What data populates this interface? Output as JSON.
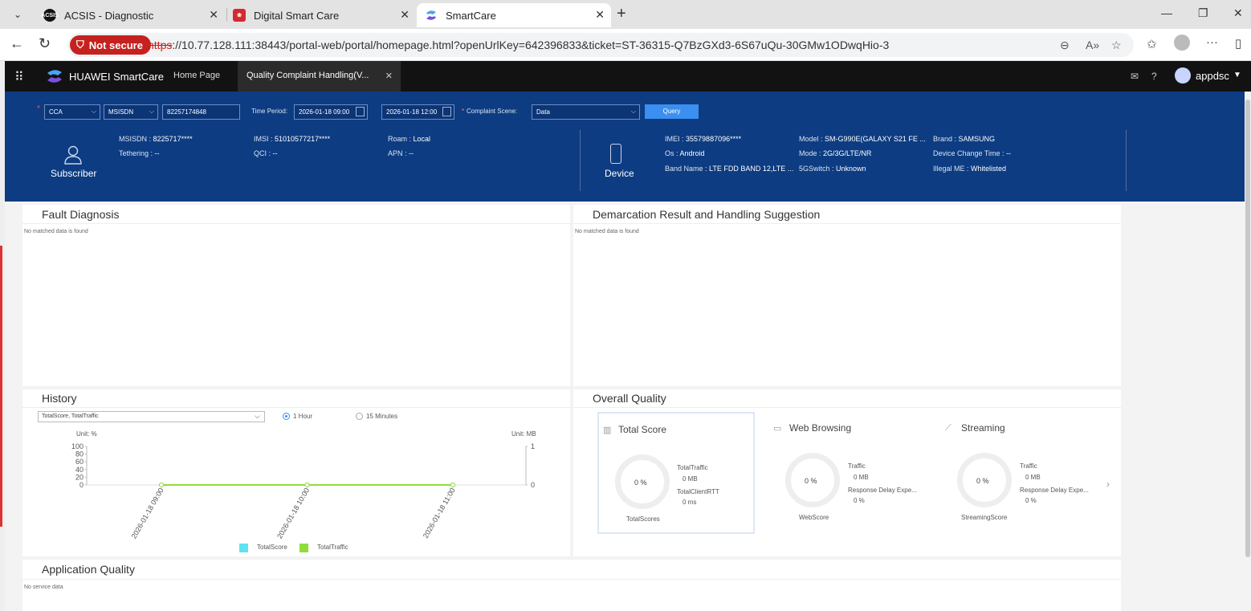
{
  "browser": {
    "tabs": [
      {
        "title": "ACSIS - Diagnostic",
        "favicon": "acsis-icon"
      },
      {
        "title": "Digital Smart Care",
        "favicon": "huawei-icon"
      },
      {
        "title": "SmartCare",
        "favicon": "smartcare-icon",
        "active": true
      }
    ],
    "security_label": "Not secure",
    "url_protocol": "https",
    "url_rest": "://10.77.128.111:38443/portal-web/portal/homepage.html?openUrlKey=642396833&ticket=ST-36315-Q7BzGXd3-6S67uQu-30GMw1ODwqHio-3"
  },
  "app": {
    "brand": "HUAWEI SmartCare",
    "nav": {
      "home": "Home Page",
      "active_tab": "Quality Complaint Handling(V..."
    },
    "user": "appdsc"
  },
  "query": {
    "type": "CCA",
    "id_type": "MSISDN",
    "id_value": "82257174848",
    "time_period_label": "Time Period:",
    "start_time": "2026-01-18 09:00",
    "end_time": "2026-01-18 12:00",
    "scene_label": "Complaint Scene:",
    "scene_value": "Data",
    "query_button": "Query"
  },
  "subscriber": {
    "label": "Subscriber",
    "msisdn_label": "MSISDN",
    "msisdn": "8225717****",
    "imsi_label": "IMSI",
    "imsi": "51010577217****",
    "roam_label": "Roam",
    "roam": "Local",
    "tethering_label": "Tethering",
    "tethering": "--",
    "qci_label": "QCI",
    "qci": "--",
    "apn_label": "APN",
    "apn": "--"
  },
  "device": {
    "label": "Device",
    "imei_label": "IMEI",
    "imei": "35579887096****",
    "model_label": "Model",
    "model": "SM-G990E(GALAXY S21 FE ...",
    "brand_label": "Brand",
    "brand": "SAMSUNG",
    "os_label": "Os",
    "os": "Android",
    "mode_label": "Mode",
    "mode": "2G/3G/LTE/NR",
    "change_label": "Device Change Time",
    "change": "--",
    "band_label": "Band Name",
    "band": "LTE FDD BAND 12,LTE ...",
    "fiveg_label": "5GSwitch",
    "fiveg": "Unknown",
    "illegal_label": "Illegal ME",
    "illegal": "Whitelisted"
  },
  "fault": {
    "title": "Fault Diagnosis",
    "empty": "No matched data is found"
  },
  "demarcation": {
    "title": "Demarcation Result and Handling Suggestion",
    "empty": "No matched data is found"
  },
  "history": {
    "title": "History",
    "selector": "TotalScore, TotalTraffic",
    "radio_1h": "1 Hour",
    "radio_15m": "15 Minutes",
    "unit_left": "Unit: %",
    "unit_right": "Unit: MB"
  },
  "chart_data": {
    "type": "line",
    "x": [
      "2026-01-18 09:00",
      "2026-01-18 10:00",
      "2026-01-18 11:00"
    ],
    "series": [
      {
        "name": "TotalScore",
        "values": [
          0,
          0,
          0
        ],
        "color": "#5ee3f0"
      },
      {
        "name": "TotalTraffic",
        "values": [
          0,
          0,
          0
        ],
        "color": "#8fdc3c"
      }
    ],
    "y_ticks_left": [
      "100",
      "80",
      "60",
      "40",
      "20",
      "0"
    ],
    "y_ticks_right": [
      "1",
      "0"
    ],
    "ylim": [
      0,
      100
    ]
  },
  "overall": {
    "title": "Overall Quality",
    "total": {
      "title": "Total Score",
      "score": "0 %",
      "score_label": "TotalScores",
      "k1": "TotalTraffic",
      "v1": "0 MB",
      "k2": "TotalClientRTT",
      "v2": "0 ms"
    },
    "web": {
      "title": "Web Browsing",
      "score": "0 %",
      "score_label": "WebScore",
      "k1": "Traffic",
      "v1": "0 MB",
      "k2": "Response Delay Expe...",
      "v2": "0 %"
    },
    "stream": {
      "title": "Streaming",
      "score": "0 %",
      "score_label": "StreamingScore",
      "k1": "Traffic",
      "v1": "0 MB",
      "k2": "Response Delay Expe...",
      "v2": "0 %"
    }
  },
  "app_quality": {
    "title": "Application Quality",
    "empty": "No service data"
  }
}
